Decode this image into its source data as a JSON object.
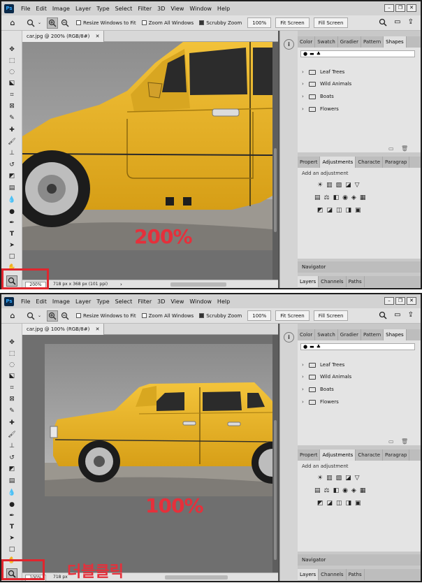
{
  "app": {
    "logo": "Ps"
  },
  "menu": [
    "File",
    "Edit",
    "Image",
    "Layer",
    "Type",
    "Select",
    "Filter",
    "3D",
    "View",
    "Window",
    "Help"
  ],
  "options": {
    "resize_windows": "Resize Windows to Fit",
    "zoom_all": "Zoom All Windows",
    "scrubby": "Scrubby Zoom",
    "zoom_pct": "100%",
    "fit_screen": "Fit Screen",
    "fill_screen": "Fill Screen"
  },
  "panel_top": {
    "doc_tab": "car.jpg @ 200% (RGB/8#)",
    "status_zoom": "200%",
    "doc_info": "718 px x 368 px (101 ppi)",
    "overlay_zoom": "200%"
  },
  "panel_bottom": {
    "doc_tab": "car.jpg @ 100% (RGB/8#)",
    "status_zoom": "100%",
    "doc_info": "718 px",
    "overlay_zoom": "100%"
  },
  "annotation": {
    "double_click": "더블클릭"
  },
  "right_panel": {
    "top_tabs": [
      "Color",
      "Swatch",
      "Gradier",
      "Pattern",
      "Shapes"
    ],
    "shape_folders": [
      "Leaf Trees",
      "Wild Animals",
      "Boats",
      "Flowers"
    ],
    "mid_tabs": [
      "Propert",
      "Adjustments",
      "Characte",
      "Paragrap"
    ],
    "add_adjustment": "Add an adjustment",
    "navigator": "Navigator",
    "bottom_tabs": [
      "Layers",
      "Channels",
      "Paths"
    ]
  },
  "colors": {
    "accent_red": "#e5303b",
    "car_yellow": "#e8b321"
  },
  "icons": {
    "home": "home-icon",
    "zoom": "zoom-tool-icon",
    "info": "info-icon",
    "search": "search-icon"
  }
}
